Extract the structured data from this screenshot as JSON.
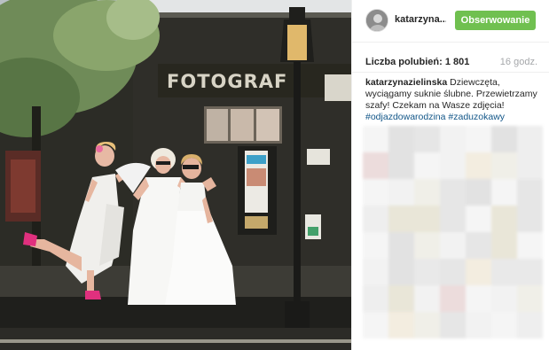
{
  "photo": {
    "store_sign": "FOTOGRAF",
    "accent_colors": {
      "sky": "#c9cfd3",
      "facade": "#2c2c27",
      "dress": "#f4f4f2",
      "pink": "#e0307e"
    }
  },
  "header": {
    "username": "katarzyna...",
    "follow_label": "Obserwowanie"
  },
  "stats": {
    "likes_label": "Liczba polubień: 1 801",
    "time_ago": "16 godz."
  },
  "caption": {
    "author": "katarzynazielinska",
    "text": " Dziewczęta, wyciągamy suknie ślubne. Przewietrzamy szafy! Czekam na Wasze zdjęcia!",
    "hashtags": [
      "#odjazdowarodzina",
      "#zaduzokawy"
    ]
  },
  "colors": {
    "follow_button": "#70c050",
    "hashtag": "#125688",
    "muted_text": "#a5a7aa"
  }
}
